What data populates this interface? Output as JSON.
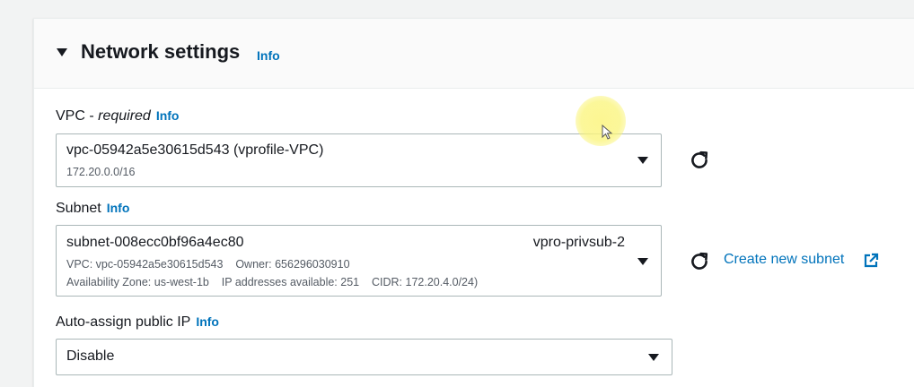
{
  "network_settings": {
    "title": "Network settings",
    "info_label": "Info"
  },
  "vpc": {
    "label_prefix": "VPC - ",
    "label_required": "required",
    "info_label": "Info",
    "selected_value": "vpc-05942a5e30615d543 (vprofile-VPC)",
    "selected_detail": "172.20.0.0/16"
  },
  "subnet": {
    "label": "Subnet",
    "info_label": "Info",
    "selected_value": "subnet-008ecc0bf96a4ec80",
    "selected_name": "vpro-privsub-2",
    "detail_line1": "VPC: vpc-05942a5e30615d543    Owner: 656296030910",
    "detail_line2": "Availability Zone: us-west-1b    IP addresses available: 251    CIDR: 172.20.4.0/24)",
    "create_link": "Create new subnet"
  },
  "auto_assign_ip": {
    "label": "Auto-assign public IP",
    "info_label": "Info",
    "selected_value": "Disable"
  },
  "icons": {
    "section_toggle": "caret-down-icon",
    "dropdown": "caret-down-icon",
    "refresh": "refresh-icon",
    "external": "external-link-icon"
  },
  "colors": {
    "link": "#0073bb",
    "text": "#16191f",
    "secondary_text": "#545b64",
    "border": "#aab7b8",
    "header_bg": "#fafafa",
    "page_bg": "#f2f3f3"
  }
}
